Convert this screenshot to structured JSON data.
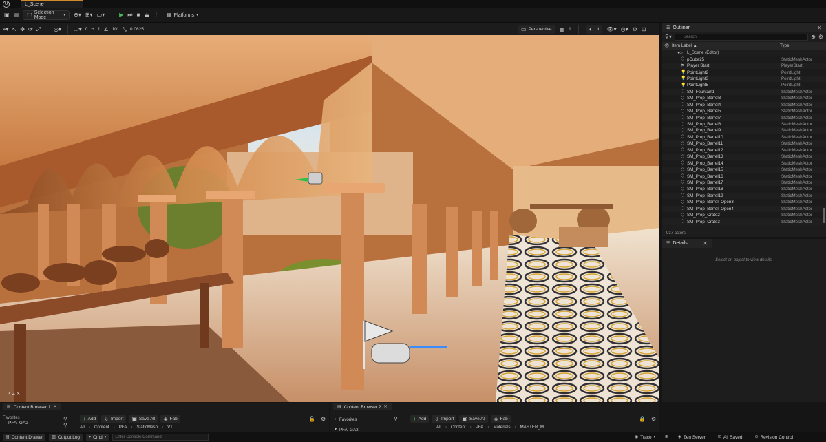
{
  "titlebar": {
    "scene_tab": "L_Scene"
  },
  "toolbar": {
    "mode": "Selection Mode",
    "platforms": "Platforms"
  },
  "viewport_toolbar": {
    "grid_rot": "0",
    "grid_size": "1",
    "rot_snap": "10°",
    "scale_snap": "0.0625",
    "perspective": "Perspective",
    "camera_speed": "1",
    "lit": "Lit"
  },
  "outliner": {
    "tab": "Outliner",
    "search_placeholder": "Search",
    "col_label": "Item Label ▲",
    "col_type": "Type",
    "scene_root": "L_Scene (Editor)",
    "count": "937 actors",
    "rows": [
      {
        "name": "pCube25",
        "type": "StaticMeshActor"
      },
      {
        "name": "Player Start",
        "type": "PlayerStart"
      },
      {
        "name": "PointLight2",
        "type": "PointLight"
      },
      {
        "name": "PointLight3",
        "type": "PointLight"
      },
      {
        "name": "PointLight5",
        "type": "PointLight"
      },
      {
        "name": "SM_Fountain1",
        "type": "StaticMeshActor"
      },
      {
        "name": "SM_Prop_Barrel3",
        "type": "StaticMeshActor"
      },
      {
        "name": "SM_Prop_Barrel4",
        "type": "StaticMeshActor"
      },
      {
        "name": "SM_Prop_Barrel5",
        "type": "StaticMeshActor"
      },
      {
        "name": "SM_Prop_Barrel7",
        "type": "StaticMeshActor"
      },
      {
        "name": "SM_Prop_Barrel8",
        "type": "StaticMeshActor"
      },
      {
        "name": "SM_Prop_Barrel9",
        "type": "StaticMeshActor"
      },
      {
        "name": "SM_Prop_Barrel10",
        "type": "StaticMeshActor"
      },
      {
        "name": "SM_Prop_Barrel11",
        "type": "StaticMeshActor"
      },
      {
        "name": "SM_Prop_Barrel12",
        "type": "StaticMeshActor"
      },
      {
        "name": "SM_Prop_Barrel13",
        "type": "StaticMeshActor"
      },
      {
        "name": "SM_Prop_Barrel14",
        "type": "StaticMeshActor"
      },
      {
        "name": "SM_Prop_Barrel15",
        "type": "StaticMeshActor"
      },
      {
        "name": "SM_Prop_Barrel16",
        "type": "StaticMeshActor"
      },
      {
        "name": "SM_Prop_Barrel17",
        "type": "StaticMeshActor"
      },
      {
        "name": "SM_Prop_Barrel18",
        "type": "StaticMeshActor"
      },
      {
        "name": "SM_Prop_Barrel19",
        "type": "StaticMeshActor"
      },
      {
        "name": "SM_Prop_Barrel_Open3",
        "type": "StaticMeshActor"
      },
      {
        "name": "SM_Prop_Barrel_Open4",
        "type": "StaticMeshActor"
      },
      {
        "name": "SM_Prop_Crate2",
        "type": "StaticMeshActor"
      },
      {
        "name": "SM_Prop_Crate3",
        "type": "StaticMeshActor"
      }
    ]
  },
  "details": {
    "tab": "Details",
    "empty": "Select an object to view details."
  },
  "content_browser_1": {
    "tab": "Content Browser 1",
    "favorites": "Favorites",
    "folder": "PFA_GA2",
    "add": "Add",
    "import": "Import",
    "save_all": "Save All",
    "fab": "Fab",
    "path": [
      "All",
      "Content",
      "PFA",
      "StaticMesh",
      "V1"
    ]
  },
  "content_browser_2": {
    "tab": "Content Browser 2",
    "favorites": "Favorites",
    "folder": "PFA_GA2",
    "add": "Add",
    "import": "Import",
    "save_all": "Save All",
    "fab": "Fab",
    "path": [
      "All",
      "Content",
      "PFA",
      "Materials",
      "MASTER_M"
    ]
  },
  "statusbar": {
    "content_drawer": "Content Drawer",
    "output_log": "Output Log",
    "cmd": "Cmd",
    "console_placeholder": "Enter Console Command",
    "trace": "Trace",
    "zen": "Zen Server",
    "all_saved": "All Saved",
    "revision": "Revision Control"
  },
  "colors": {
    "accent": "#d08a2b",
    "bg": "#151515",
    "panel": "#1d1d1d",
    "play_green": "#4cbb5a"
  }
}
